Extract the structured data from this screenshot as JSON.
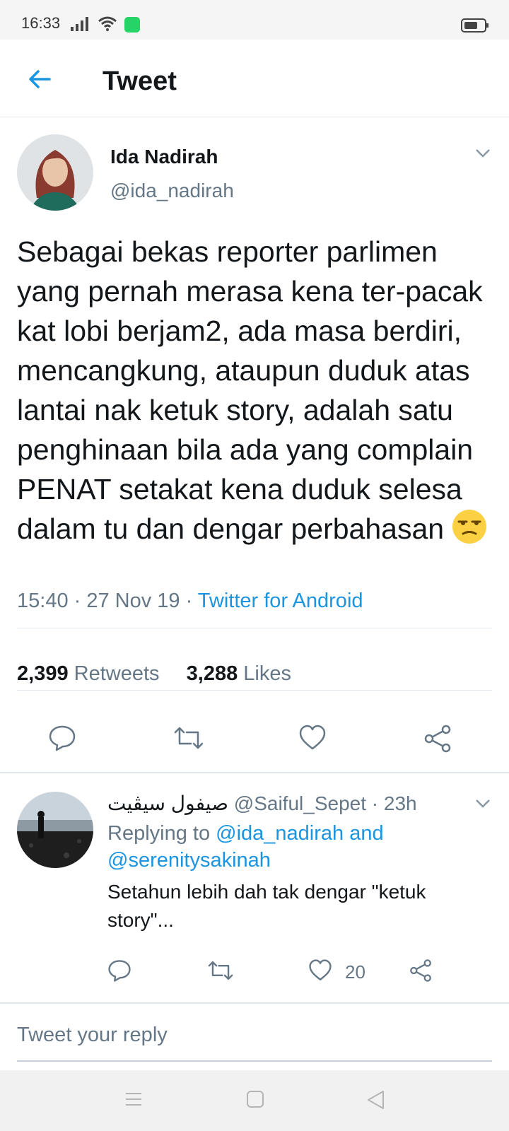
{
  "status_bar": {
    "time": "16:33"
  },
  "header": {
    "title": "Tweet"
  },
  "tweet": {
    "author_name": "Ida Nadirah",
    "author_handle": "@ida_nadirah",
    "text": "Sebagai bekas reporter parlimen yang pernah merasa kena ter-pacak kat lobi berjam2, ada masa berdiri, mencangkung, ataupun duduk atas lantai nak ketuk story, adalah satu penghinaan bila ada yang complain PENAT setakat kena duduk selesa dalam tu dan dengar perbahasan",
    "time_date": "15:40 · 27 Nov 19 · ",
    "source": "Twitter for Android",
    "retweet_count": "2,399",
    "retweet_label": "Retweets",
    "like_count": "3,288",
    "like_label": "Likes"
  },
  "reply": {
    "author_name": "صيفول سيڤيت",
    "author_handle": "@Saiful_Sepet",
    "time": " · 23h",
    "replying_prefix": "Replying to ",
    "replying_to": "@ida_nadirah and @serenitysakinah",
    "text": "Setahun lebih dah tak dengar \"ketuk story\"...",
    "like_count": "20"
  },
  "compose": {
    "placeholder": "Tweet your reply"
  },
  "colors": {
    "accent": "#1b95e0",
    "muted": "#657786",
    "text": "#14171a",
    "divider": "#e1e8ed"
  },
  "icons": {
    "back": "arrow-left-icon",
    "caret": "chevron-down-icon",
    "reply": "comment-icon",
    "retweet": "retweet-icon",
    "like": "heart-icon",
    "share": "share-icon",
    "emoji": "unamused-face-emoji"
  }
}
